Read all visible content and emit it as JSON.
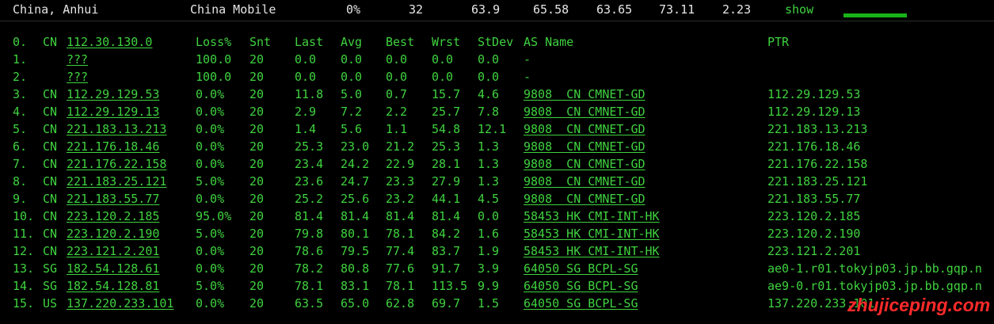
{
  "summary": {
    "location": "China, Anhui",
    "isp": "China Mobile",
    "loss": "0%",
    "sent": "32",
    "last": "63.9",
    "avg": "65.58",
    "best": "63.65",
    "worst": "73.11",
    "stdev": "2.23",
    "show_label": "show"
  },
  "header": {
    "num": "0.",
    "cc": "CN",
    "ip": "112.30.130.0",
    "loss": "Loss%",
    "snt": "Snt",
    "last": "Last",
    "avg": "Avg",
    "best": "Best",
    "wrst": "Wrst",
    "stdev": "StDev",
    "as_name": "AS Name",
    "ptr": "PTR"
  },
  "hops": [
    {
      "num": "1.",
      "cc": "",
      "ip": "???",
      "loss": "100.0",
      "snt": "20",
      "last": "0.0",
      "avg": "0.0",
      "best": "0.0",
      "wrst": "0.0",
      "std": "0.0",
      "as": "-",
      "ptr": ""
    },
    {
      "num": "2.",
      "cc": "",
      "ip": "???",
      "loss": "100.0",
      "snt": "20",
      "last": "0.0",
      "avg": "0.0",
      "best": "0.0",
      "wrst": "0.0",
      "std": "0.0",
      "as": "-",
      "ptr": ""
    },
    {
      "num": "3.",
      "cc": "CN",
      "ip": "112.29.129.53",
      "loss": "0.0%",
      "snt": "20",
      "last": "11.8",
      "avg": "5.0",
      "best": "0.7",
      "wrst": "15.7",
      "std": "4.6",
      "as": "9808  CN CMNET-GD",
      "ptr": "112.29.129.53"
    },
    {
      "num": "4.",
      "cc": "CN",
      "ip": "112.29.129.13",
      "loss": "0.0%",
      "snt": "20",
      "last": "2.9",
      "avg": "7.2",
      "best": "2.2",
      "wrst": "25.7",
      "std": "7.8",
      "as": "9808  CN CMNET-GD",
      "ptr": "112.29.129.13"
    },
    {
      "num": "5.",
      "cc": "CN",
      "ip": "221.183.13.213",
      "loss": "0.0%",
      "snt": "20",
      "last": "1.4",
      "avg": "5.6",
      "best": "1.1",
      "wrst": "54.8",
      "std": "12.1",
      "as": "9808  CN CMNET-GD",
      "ptr": "221.183.13.213"
    },
    {
      "num": "6.",
      "cc": "CN",
      "ip": "221.176.18.46",
      "loss": "0.0%",
      "snt": "20",
      "last": "25.3",
      "avg": "23.0",
      "best": "21.2",
      "wrst": "25.3",
      "std": "1.3",
      "as": "9808  CN CMNET-GD",
      "ptr": "221.176.18.46"
    },
    {
      "num": "7.",
      "cc": "CN",
      "ip": "221.176.22.158",
      "loss": "0.0%",
      "snt": "20",
      "last": "23.4",
      "avg": "24.2",
      "best": "22.9",
      "wrst": "28.1",
      "std": "1.3",
      "as": "9808  CN CMNET-GD",
      "ptr": "221.176.22.158"
    },
    {
      "num": "8.",
      "cc": "CN",
      "ip": "221.183.25.121",
      "loss": "5.0%",
      "snt": "20",
      "last": "23.6",
      "avg": "24.7",
      "best": "23.3",
      "wrst": "27.9",
      "std": "1.3",
      "as": "9808  CN CMNET-GD",
      "ptr": "221.183.25.121"
    },
    {
      "num": "9.",
      "cc": "CN",
      "ip": "221.183.55.77",
      "loss": "0.0%",
      "snt": "20",
      "last": "25.2",
      "avg": "25.6",
      "best": "23.2",
      "wrst": "44.1",
      "std": "4.5",
      "as": "9808  CN CMNET-GD",
      "ptr": "221.183.55.77"
    },
    {
      "num": "10.",
      "cc": "CN",
      "ip": "223.120.2.185",
      "loss": "95.0%",
      "snt": "20",
      "last": "81.4",
      "avg": "81.4",
      "best": "81.4",
      "wrst": "81.4",
      "std": "0.0",
      "as": "58453 HK CMI-INT-HK",
      "ptr": "223.120.2.185"
    },
    {
      "num": "11.",
      "cc": "CN",
      "ip": "223.120.2.190",
      "loss": "5.0%",
      "snt": "20",
      "last": "79.8",
      "avg": "80.1",
      "best": "78.1",
      "wrst": "84.2",
      "std": "1.6",
      "as": "58453 HK CMI-INT-HK",
      "ptr": "223.120.2.190"
    },
    {
      "num": "12.",
      "cc": "CN",
      "ip": "223.121.2.201",
      "loss": "0.0%",
      "snt": "20",
      "last": "78.6",
      "avg": "79.5",
      "best": "77.4",
      "wrst": "83.7",
      "std": "1.9",
      "as": "58453 HK CMI-INT-HK",
      "ptr": "223.121.2.201"
    },
    {
      "num": "13.",
      "cc": "SG",
      "ip": "182.54.128.61",
      "loss": "0.0%",
      "snt": "20",
      "last": "78.2",
      "avg": "80.8",
      "best": "77.6",
      "wrst": "91.7",
      "std": "3.9",
      "as": "64050 SG BCPL-SG",
      "ptr": "ae0-1.r01.tokyjp03.jp.bb.gqp.n"
    },
    {
      "num": "14.",
      "cc": "SG",
      "ip": "182.54.128.81",
      "loss": "5.0%",
      "snt": "20",
      "last": "78.1",
      "avg": "83.1",
      "best": "78.1",
      "wrst": "113.5",
      "std": "9.9",
      "as": "64050 SG BCPL-SG",
      "ptr": "ae9-0.r01.tokyjp03.jp.bb.gqp.n"
    },
    {
      "num": "15.",
      "cc": "US",
      "ip": "137.220.233.101",
      "loss": "0.0%",
      "snt": "20",
      "last": "63.5",
      "avg": "65.0",
      "best": "62.8",
      "wrst": "69.7",
      "std": "1.5",
      "as": "64050 SG BCPL-SG",
      "ptr": "137.220.233.101"
    }
  ],
  "watermark": "zhujiceping.com",
  "colors": {
    "text": "#3fd23f",
    "background": "#000000",
    "summary_text": "#e6e6e6",
    "watermark": "#ff2a2a"
  }
}
